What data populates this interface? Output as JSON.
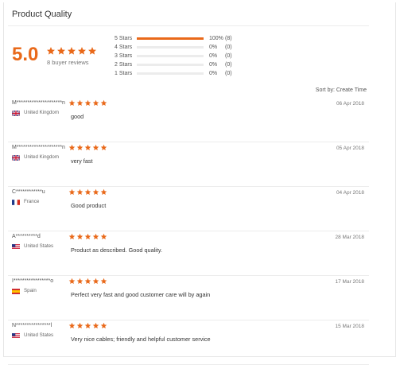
{
  "header": {
    "title": "Product Quality"
  },
  "summary": {
    "score": "5.0",
    "rating": 5,
    "reviews_label": "8 buyer reviews",
    "accent_color": "#e9691a"
  },
  "histogram": [
    {
      "label": "5 Stars",
      "percent_label": "100%",
      "count_label": "(8)",
      "share": 1.0
    },
    {
      "label": "4 Stars",
      "percent_label": "0%",
      "count_label": "(0)",
      "share": 0
    },
    {
      "label": "3 Stars",
      "percent_label": "0%",
      "count_label": "(0)",
      "share": 0
    },
    {
      "label": "2 Stars",
      "percent_label": "0%",
      "count_label": "(0)",
      "share": 0
    },
    {
      "label": "1 Stars",
      "percent_label": "0%",
      "count_label": "(0)",
      "share": 0
    }
  ],
  "sort": {
    "label": "Sort by: Create Time"
  },
  "reviews": [
    {
      "name": "M*********************n",
      "country": "United Kingdom",
      "flag": "uk-flag-icon",
      "rating": 5,
      "date": "06 Apr 2018",
      "text": "good"
    },
    {
      "name": "M*********************n",
      "country": "United Kingdom",
      "flag": "uk-flag-icon",
      "rating": 5,
      "date": "05 Apr 2018",
      "text": "very fast"
    },
    {
      "name": "C************u",
      "country": "France",
      "flag": "france-flag-icon",
      "rating": 5,
      "date": "04 Apr 2018",
      "text": "Good product"
    },
    {
      "name": "A**********d",
      "country": "United States",
      "flag": "us-flag-icon",
      "rating": 5,
      "date": "28 Mar 2018",
      "text": "Product as described. Good quality."
    },
    {
      "name": "I*****************o",
      "country": "Spain",
      "flag": "spain-flag-icon",
      "rating": 5,
      "date": "17 Mar 2018",
      "text": "Perfect very fast and good customer care will by again"
    },
    {
      "name": "N****************l",
      "country": "United States",
      "flag": "us-flag-icon",
      "rating": 5,
      "date": "15 Mar 2018",
      "text": "Very nice cables; friendly and helpful customer service"
    }
  ]
}
